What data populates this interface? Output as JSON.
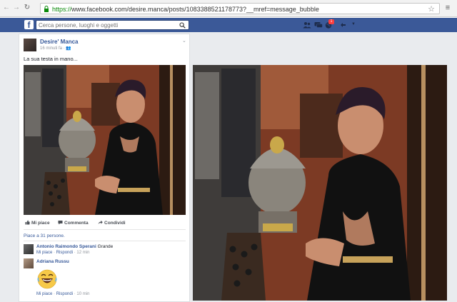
{
  "browser": {
    "url_protocol": "https://",
    "url_rest": "www.facebook.com/desire.manca/posts/1083388521178773?__mref=message_bubble"
  },
  "fb": {
    "search_placeholder": "Cerca persone, luoghi e oggetti",
    "notifications_count": "1",
    "brand_color": "#3b5998"
  },
  "post": {
    "author": "Desire' Manca",
    "time": "16 minuti fa",
    "text": "La sua testa in mano...",
    "actions": {
      "like": "Mi piace",
      "comment": "Commenta",
      "share": "Condividi"
    },
    "likes_text": "Piace a 31 persone."
  },
  "comments": [
    {
      "name": "Antonio Raimondo Sperani",
      "body": "Grande",
      "like": "Mi piace",
      "reply": "Rispondi",
      "time": "12 min"
    },
    {
      "name": "Adriana Russu",
      "body": "",
      "like": "Mi piace",
      "reply": "Rispondi",
      "time": "10 min",
      "sticker": "laughing-emoji"
    }
  ]
}
